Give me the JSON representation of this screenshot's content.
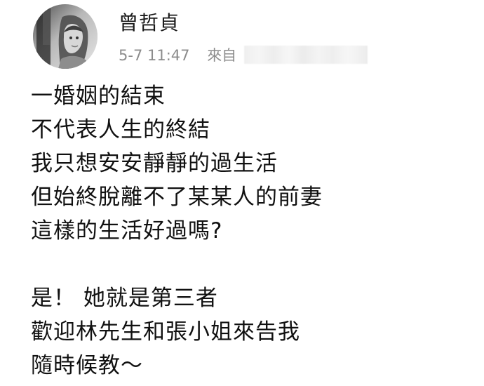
{
  "post": {
    "author_name": "曾哲貞",
    "time": "5-7 11:47",
    "source_label": "來自",
    "lines": [
      "一婚姻的結束",
      "不代表人生的終結",
      "我只想安安靜靜的過生活",
      "但始終脫離不了某某人的前妻",
      "這樣的生活好過嗎?",
      "",
      "是！ 她就是第三者",
      "歡迎林先生和張小姐來告我",
      "隨時候教～"
    ]
  },
  "icons": {
    "avatar": "profile-photo-icon"
  }
}
